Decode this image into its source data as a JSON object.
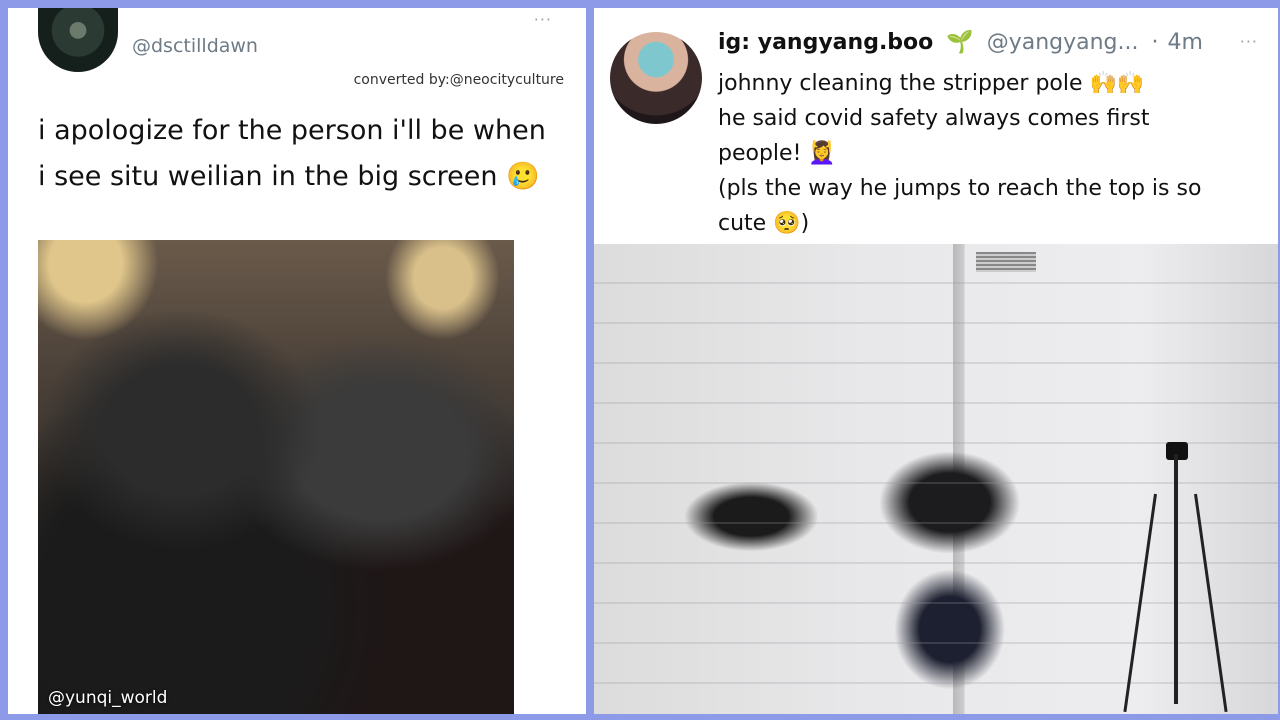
{
  "left_tweet": {
    "handle": "@dsctilldawn",
    "converted_by": "converted by:@neocityculture",
    "text": "i apologize for the person i'll be when i see situ weilian in the big screen 🥲",
    "media_watermark": "@yunqi_world",
    "more_label": "···"
  },
  "right_tweet": {
    "display_name": "ig: yangyang.boo",
    "name_emoji": "🌱",
    "handle": "@yangyang...",
    "time_separator": "·",
    "time": "4m",
    "more_label": "···",
    "text_lines": [
      "johnny cleaning the stripper pole 🙌🙌",
      "he said covid safety always comes first",
      "people! 💆‍♀️",
      "(pls the way he jumps to reach the top is so",
      "cute 🥺)"
    ]
  },
  "colors": {
    "background": "#8d9ae8",
    "card": "#ffffff",
    "handle_gray": "#6e7b86"
  }
}
